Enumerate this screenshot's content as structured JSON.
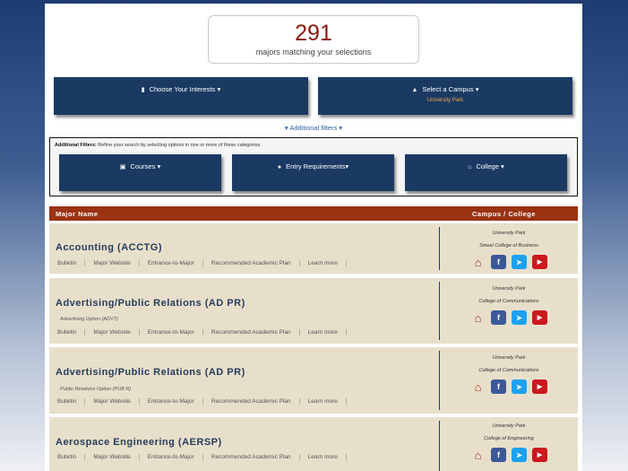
{
  "summary": {
    "count": "291",
    "label": "majors matching your selections"
  },
  "filters": {
    "interests_label": "Choose Your Interests",
    "campus_label": "Select a Campus",
    "campus_selected": "University Park",
    "additional_link": "Additional filters",
    "additional_title": "Additional Filters:",
    "additional_desc": "Refine your search by selecting options in one or more of these categories.",
    "courses_label": "Courses",
    "entry_label": "Entry Requirements",
    "college_label": "College"
  },
  "table": {
    "col_major": "Major Name",
    "col_campus": "Campus / College",
    "link_labels": [
      "Bulletin",
      "Major Website",
      "Entrance-to-Major",
      "Recommended Academic Plan",
      "Learn more"
    ],
    "rows": [
      {
        "title": "Accounting (ACCTG)",
        "option": "",
        "campus": "University Park",
        "college": "Smeal College of Business"
      },
      {
        "title": "Advertising/Public Relations (AD PR)",
        "option": "Advertising Option (ADVT)",
        "campus": "University Park",
        "college": "College of Communications"
      },
      {
        "title": "Advertising/Public Relations (AD PR)",
        "option": "Public Relations Option (PUB R)",
        "campus": "University Park",
        "college": "College of Communications"
      },
      {
        "title": "Aerospace Engineering (AERSP)",
        "option": "",
        "campus": "University Park",
        "college": "College of Engineering"
      }
    ]
  },
  "icons": {
    "bookmark": "bookmark-icon",
    "campus": "graduation-cap-icon",
    "courses": "book-icon",
    "entry": "apple-icon",
    "college": "home-icon",
    "social": [
      "home-icon",
      "facebook-icon",
      "twitter-icon",
      "youtube-icon"
    ]
  },
  "colors": {
    "navy": "#1b3a63",
    "header_rust": "#9b3212",
    "row_tan": "#e8dfcb",
    "count_red": "#8b1a12",
    "campus_orange": "#f2a34a"
  }
}
